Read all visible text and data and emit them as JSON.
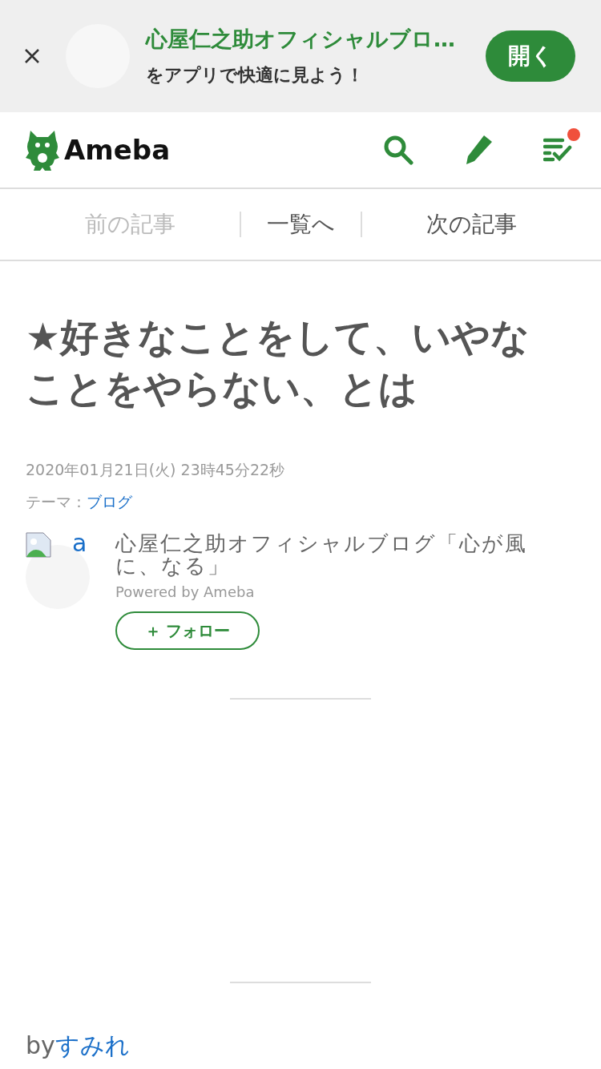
{
  "app_banner": {
    "title": "心屋仁之助オフィシャルブロ…",
    "subtitle": "をアプリで快適に見よう！",
    "open_button": "開く"
  },
  "header": {
    "logo": "Ameba",
    "notification": true
  },
  "article_nav": [
    {
      "label": "前の記事",
      "disabled": true
    },
    {
      "label": "一覧へ",
      "disabled": false
    },
    {
      "label": "次の記事",
      "disabled": false
    }
  ],
  "article": {
    "title": "★好きなことをして、いやなことをやらない、とは",
    "date": "2020年01月21日(火) 23時45分22秒",
    "theme_label": "テーマ：",
    "theme": "ブログ"
  },
  "blog": {
    "avatar_alt": "a",
    "name": "心屋仁之助オフィシャルブログ「心が風に、なる」",
    "powered": "Powered by Ameba",
    "follow_button": "＋ フォロー"
  },
  "byline": {
    "prefix": "by",
    "author": "すみれ"
  }
}
